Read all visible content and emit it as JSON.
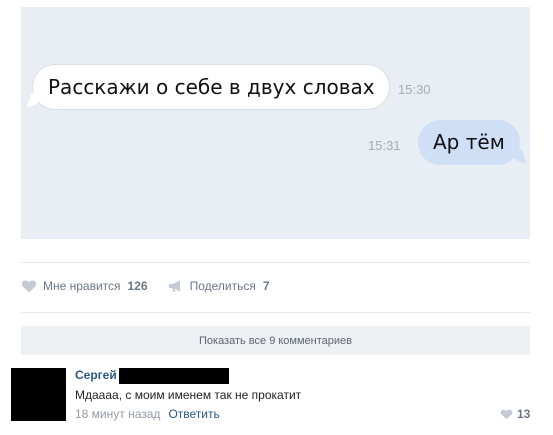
{
  "chat": {
    "incoming_text": "Расскажи о себе в двух словах",
    "incoming_time": "15:30",
    "outgoing_text": "Ар тём",
    "outgoing_time": "15:31"
  },
  "post_actions": {
    "like_label": "Мне нравится",
    "like_count": "126",
    "share_label": "Поделиться",
    "share_count": "7",
    "like_icon": "heart-icon",
    "share_icon": "megaphone-icon"
  },
  "comments": {
    "show_all_label": "Показать все 9 комментариев",
    "items": [
      {
        "author": "Сергей",
        "text": "Мдаааа, с моим именем так не прокатит",
        "time": "18 минут назад",
        "reply_label": "Ответить",
        "likes": "13"
      }
    ]
  },
  "colors": {
    "chat_background": "#e9edf4",
    "outgoing_bubble": "#cfdff5",
    "link": "#2a5885",
    "muted": "#939ba5"
  }
}
